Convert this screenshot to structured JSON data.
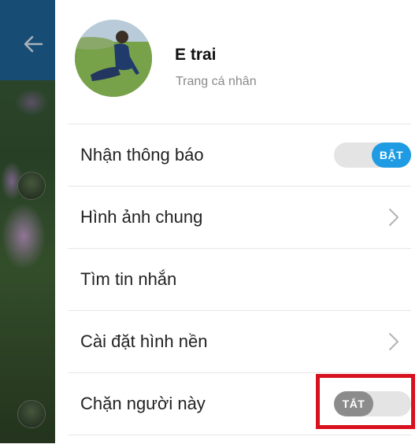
{
  "profile": {
    "name": "E trai",
    "subtitle": "Trang cá nhân"
  },
  "settings": [
    {
      "label": "Nhận thông báo",
      "control": "toggle",
      "toggle_text": "BẬT",
      "state": "on"
    },
    {
      "label": "Hình ảnh chung",
      "control": "chevron"
    },
    {
      "label": "Tìm tin nhắn",
      "control": "none"
    },
    {
      "label": "Cài đặt hình nền",
      "control": "chevron"
    },
    {
      "label": "Chặn người này",
      "control": "toggle",
      "toggle_text": "TẮT",
      "state": "off"
    }
  ],
  "icons": {
    "back": "arrow-left-icon",
    "chevron": "chevron-right-icon"
  },
  "colors": {
    "toggle_on": "#1e9be3",
    "toggle_off": "#8c8c8c",
    "highlight": "#d9111f",
    "header_blue": "#1d5f8e"
  }
}
